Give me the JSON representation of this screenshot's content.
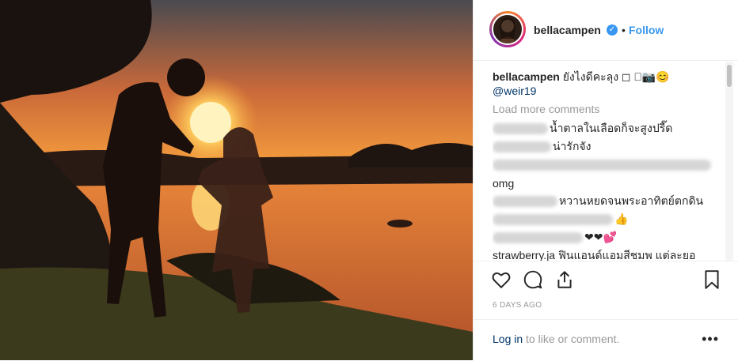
{
  "header": {
    "username": "bellacampen",
    "dot": "•",
    "follow_label": "Follow",
    "verified_icon": "verified-badge-icon"
  },
  "caption": {
    "username": "bellacampen",
    "text": "ยังไงดีคะลุง ◻ 🏻📷😊",
    "mention": "@weir19"
  },
  "load_more": "Load more comments",
  "comments": [
    {
      "text": "น้ำตาลในเลือดก็จะสูงปรี๊ด"
    },
    {
      "text": "น่ารักจัง"
    },
    {
      "text": ""
    },
    {
      "text": "omg"
    },
    {
      "text": "หวานหยดจนพระอาทิตย์ตกดิน"
    },
    {
      "text": "👍"
    },
    {
      "text": "❤❤💕"
    },
    {
      "text": "strawberry.ja ฟินแอนด์แอมสีชมพ แต่ละยอ"
    }
  ],
  "date": "6 DAYS AGO",
  "footer": {
    "login_link": "Log in",
    "login_rest": " to like or comment.",
    "more": "•••"
  },
  "icons": [
    "heart-icon",
    "comment-icon",
    "share-icon",
    "bookmark-icon",
    "more-options-icon"
  ],
  "colors": {
    "link": "#3897f0",
    "text": "#262626",
    "muted": "#999999",
    "sunset": "#f28a2e"
  }
}
